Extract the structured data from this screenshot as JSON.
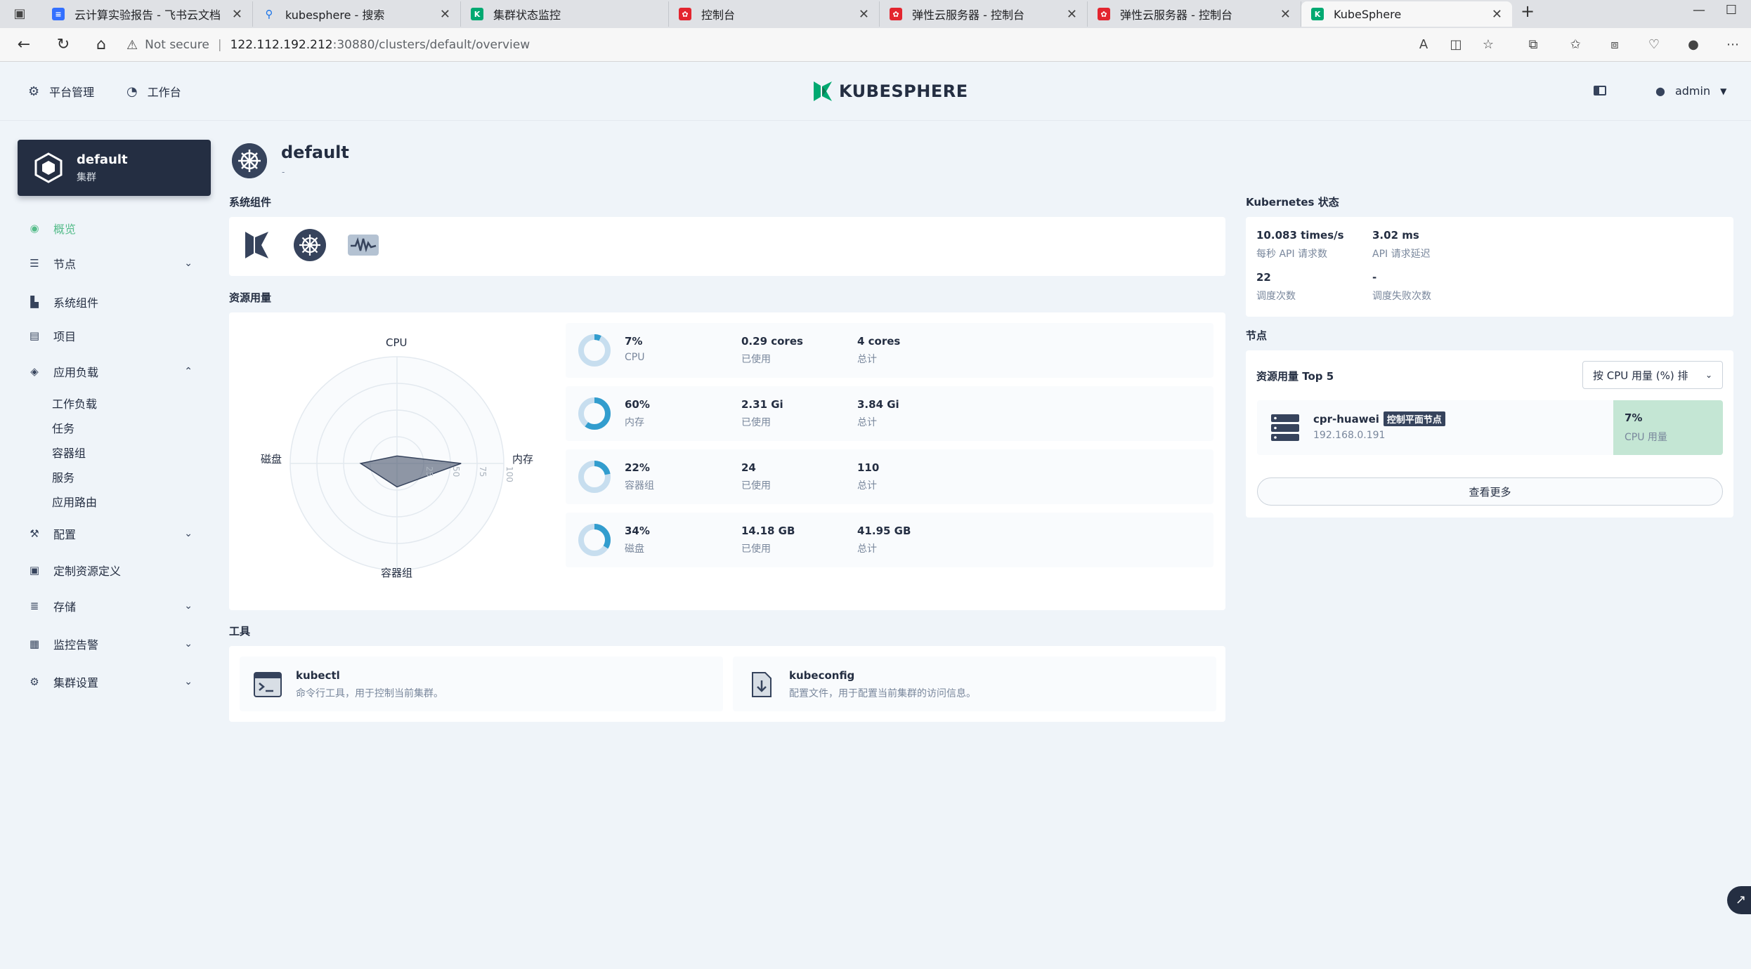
{
  "browser": {
    "tabs": [
      {
        "label": "云计算实验报告 - 飞书云文档",
        "icon": "doc-icon",
        "color": "#3370ff"
      },
      {
        "label": "kubesphere - 搜索",
        "icon": "search-icon",
        "color": "#1a73e8"
      },
      {
        "label": "集群状态监控",
        "icon": "kubesphere-icon",
        "color": "#00a971"
      },
      {
        "label": "控制台",
        "icon": "huawei-icon",
        "color": "#e3252f"
      },
      {
        "label": "弹性云服务器 - 控制台",
        "icon": "huawei-icon",
        "color": "#e3252f"
      },
      {
        "label": "弹性云服务器 - 控制台",
        "icon": "huawei-icon",
        "color": "#e3252f"
      },
      {
        "label": "KubeSphere",
        "icon": "kubesphere-icon",
        "color": "#00a971"
      }
    ],
    "not_secure": "Not secure",
    "url_host": "122.112.192.212",
    "url_rest": ":30880/clusters/default/overview"
  },
  "header": {
    "platform_label": "平台管理",
    "workbench_label": "工作台",
    "logo_text": "KUBESPHERE",
    "user": "admin"
  },
  "cluster": {
    "name": "default",
    "type": "集群"
  },
  "sidebar": {
    "overview": "概览",
    "nodes": "节点",
    "system_components": "系统组件",
    "projects": "项目",
    "app_workloads": "应用负载",
    "workloads": "工作负载",
    "jobs": "任务",
    "pods": "容器组",
    "services": "服务",
    "routes": "应用路由",
    "config": "配置",
    "crd": "定制资源定义",
    "storage": "存储",
    "monitoring": "监控告警",
    "settings": "集群设置"
  },
  "page": {
    "title": "default",
    "subtitle": "-"
  },
  "sections": {
    "system_components": "系统组件",
    "resource_usage": "资源用量",
    "tools": "工具",
    "k8s_status": "Kubernetes 状态",
    "nodes": "节点"
  },
  "radar": {
    "axes": [
      "CPU",
      "内存",
      "容器组",
      "磁盘"
    ],
    "ticks": [
      "25",
      "50",
      "75",
      "100"
    ],
    "values": [
      7,
      60,
      22,
      34
    ]
  },
  "usage": [
    {
      "percent": "7%",
      "name": "CPU",
      "used": "0.29 cores",
      "used_label": "已使用",
      "total": "4 cores",
      "total_label": "总计",
      "ratio": 0.07
    },
    {
      "percent": "60%",
      "name": "内存",
      "used": "2.31 Gi",
      "used_label": "已使用",
      "total": "3.84 Gi",
      "total_label": "总计",
      "ratio": 0.6
    },
    {
      "percent": "22%",
      "name": "容器组",
      "used": "24",
      "used_label": "已使用",
      "total": "110",
      "total_label": "总计",
      "ratio": 0.22
    },
    {
      "percent": "34%",
      "name": "磁盘",
      "used": "14.18 GB",
      "used_label": "已使用",
      "total": "41.95 GB",
      "total_label": "总计",
      "ratio": 0.34
    }
  ],
  "tools": [
    {
      "name": "kubectl",
      "desc": "命令行工具，用于控制当前集群。"
    },
    {
      "name": "kubeconfig",
      "desc": "配置文件，用于配置当前集群的访问信息。"
    }
  ],
  "k8s": {
    "api_rate": "10.083 times/s",
    "api_rate_label": "每秒 API 请求数",
    "api_latency": "3.02 ms",
    "api_latency_label": "API 请求延迟",
    "schedule": "22",
    "schedule_label": "调度次数",
    "schedule_fail": "-",
    "schedule_fail_label": "调度失败次数"
  },
  "nodes_panel": {
    "title": "资源用量 Top 5",
    "sort": "按 CPU 用量 (%) 排",
    "node_name": "cpr-huawei",
    "node_tag": "控制平面节点",
    "node_ip": "192.168.0.191",
    "cpu_value": "7%",
    "cpu_label": "CPU 用量",
    "more": "查看更多"
  },
  "colors": {
    "accent": "#55bc8a",
    "ring": "#329dce",
    "ring_bg": "#c7deef",
    "dark": "#242e42"
  }
}
